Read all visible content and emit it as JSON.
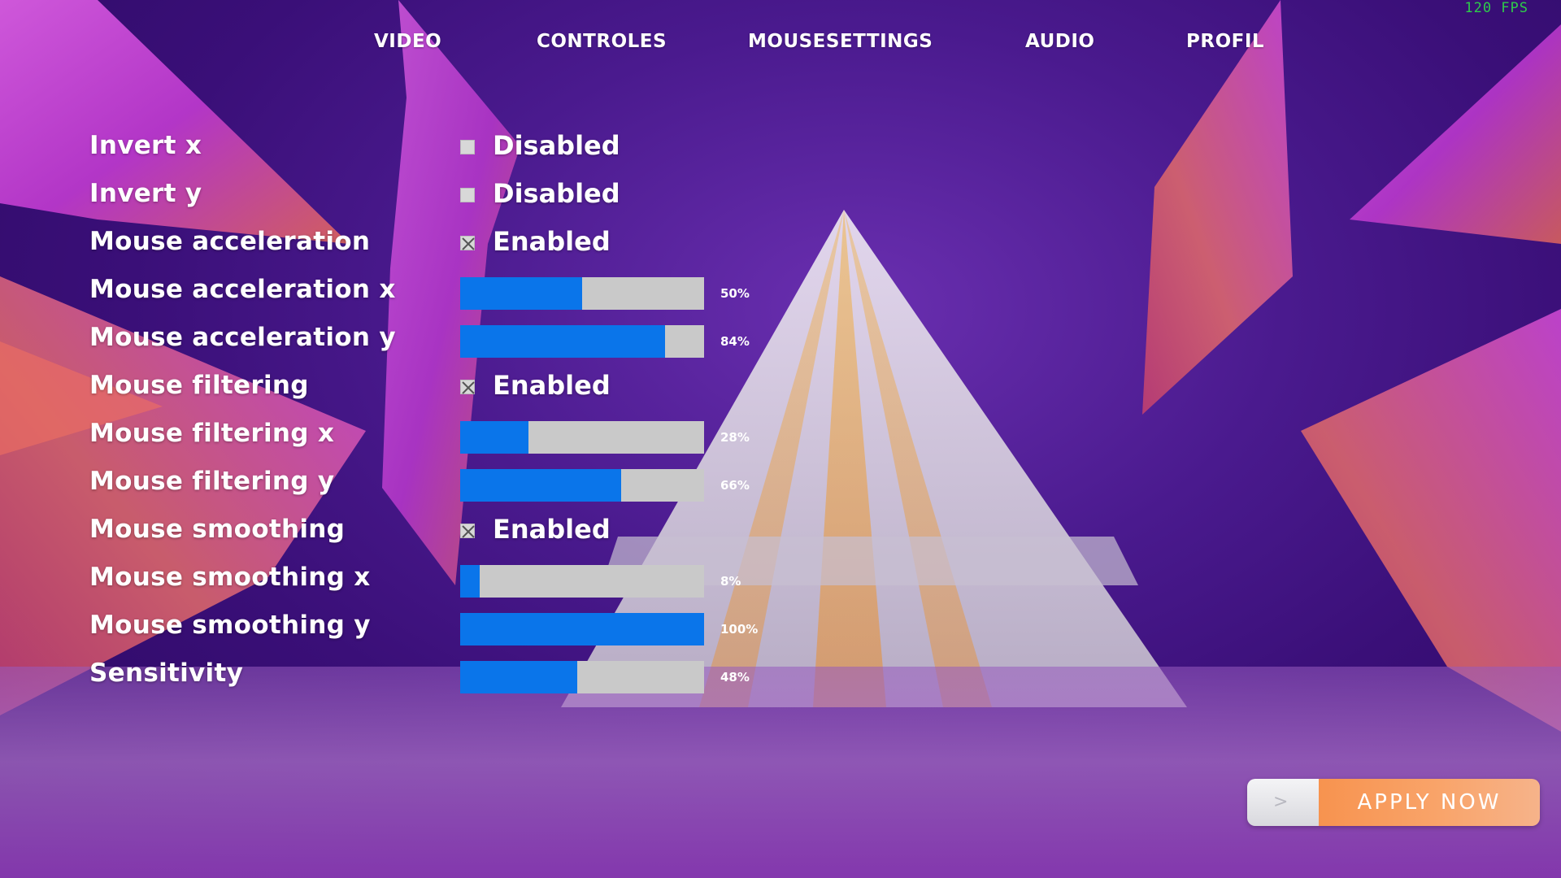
{
  "fps": "120 FPS",
  "nav": {
    "tabs": [
      {
        "label": "VIDEO"
      },
      {
        "label": "CONTROLES"
      },
      {
        "label": "MOUSESETTINGS"
      },
      {
        "label": "AUDIO"
      },
      {
        "label": "PROFIL"
      }
    ],
    "active_tab": "MOUSESETTINGS"
  },
  "settings": {
    "invert_x": {
      "label": "Invert x",
      "value": "Disabled",
      "checked": false
    },
    "invert_y": {
      "label": "Invert y",
      "value": "Disabled",
      "checked": false
    },
    "mouse_acceleration": {
      "label": "Mouse acceleration",
      "value": "Enabled",
      "checked": true
    },
    "mouse_acceleration_x": {
      "label": "Mouse acceleration x",
      "value": "50%",
      "level": 0.5
    },
    "mouse_acceleration_y": {
      "label": "Mouse acceleration y",
      "value": "84%",
      "level": 0.84
    },
    "mouse_filtering": {
      "label": "Mouse filtering",
      "value": "Enabled",
      "checked": true
    },
    "mouse_filtering_x": {
      "label": "Mouse filtering x",
      "value": "28%",
      "level": 0.28
    },
    "mouse_filtering_y": {
      "label": "Mouse filtering y",
      "value": "66%",
      "level": 0.66
    },
    "mouse_smoothing": {
      "label": "Mouse smoothing",
      "value": "Enabled",
      "checked": true
    },
    "mouse_smoothing_x": {
      "label": "Mouse smoothing x",
      "value": "8%",
      "level": 0.08
    },
    "mouse_smoothing_y": {
      "label": "Mouse smoothing y",
      "value": "100%",
      "level": 1.0
    },
    "sensitivity": {
      "label": "Sensitivity",
      "value": "48%",
      "level": 0.48
    }
  },
  "apply_button": {
    "arrow": ">",
    "label": "APPLY NOW"
  },
  "colors": {
    "slider_fill": "#0a75ea",
    "slider_track": "#c9c9c9",
    "fps_text": "#2ecc4a",
    "apply_orange": "#f7934f"
  },
  "icons": {
    "checkbox_checked": "x-mark-icon",
    "checkbox_unchecked": "empty-checkbox-icon",
    "apply_arrow": "chevron-right-icon"
  }
}
